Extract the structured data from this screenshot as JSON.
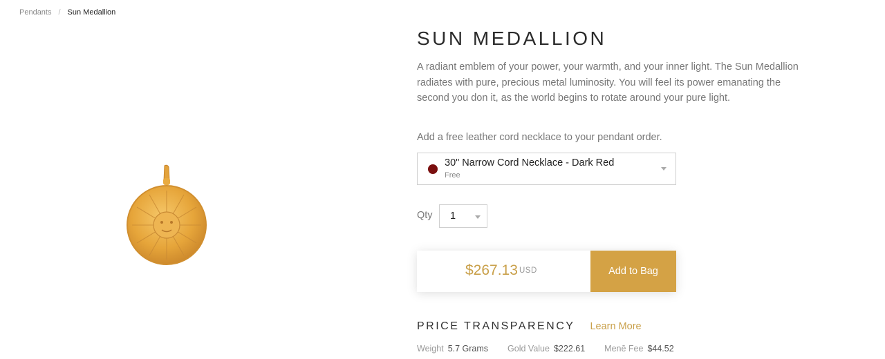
{
  "breadcrumb": {
    "parent": "Pendants",
    "separator": "/",
    "current": "Sun Medallion"
  },
  "product": {
    "title": "SUN MEDALLION",
    "description": "A radiant emblem of your power, your warmth, and your inner light. The Sun Medallion radiates with pure, precious metal luminosity. You will feel its power emanating the second you don it, as the world begins to rotate around your pure light."
  },
  "cord": {
    "prompt": "Add a free leather cord necklace to your pendant order.",
    "selected_name": "30\" Narrow Cord Necklace - Dark Red",
    "selected_price": "Free",
    "swatch_color": "#7a0f0f"
  },
  "quantity": {
    "label": "Qty",
    "value": "1"
  },
  "purchase": {
    "price": "$267.13",
    "currency": "USD",
    "add_label": "Add to Bag",
    "accent": "#d4a245"
  },
  "transparency": {
    "heading": "PRICE TRANSPARENCY",
    "learn_more": "Learn More",
    "items": [
      {
        "label": "Weight",
        "value": "5.7 Grams"
      },
      {
        "label": "Gold Value",
        "value": "$222.61"
      },
      {
        "label": "Menē Fee",
        "value": "$44.52"
      }
    ]
  },
  "icons": {
    "image": "sun-medallion-pendant",
    "dropdown": "chevron-down-icon"
  }
}
